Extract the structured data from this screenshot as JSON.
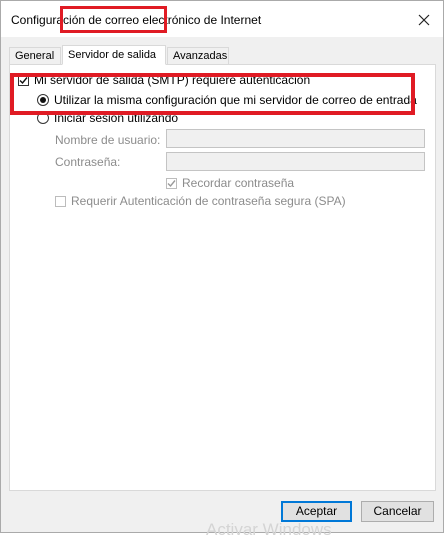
{
  "window": {
    "title": "Configuración de correo electrónico de Internet"
  },
  "tabs": [
    {
      "label": "General",
      "active": false
    },
    {
      "label": "Servidor de salida",
      "active": true
    },
    {
      "label": "Avanzadas",
      "active": false
    }
  ],
  "outgoing": {
    "require_auth_label": "Mi servidor de salida (SMTP) requiere autenticación",
    "require_auth_checked": true,
    "same_settings_label": "Utilizar la misma configuración que mi servidor de correo de entrada",
    "same_settings_selected": true,
    "login_using_label": "Iniciar sesión utilizando",
    "login_using_selected": false,
    "username_label": "Nombre de usuario:",
    "username_value": "",
    "password_label": "Contraseña:",
    "password_value": "",
    "remember_password_label": "Recordar contraseña",
    "remember_password_checked": true,
    "spa_label": "Requerir Autenticación de contraseña segura (SPA)",
    "spa_checked": false
  },
  "buttons": {
    "ok_label": "Aceptar",
    "cancel_label": "Cancelar"
  },
  "watermark": "Activar Windows",
  "colors": {
    "highlight": "#e01b24",
    "default_button_border": "#0078d7"
  }
}
